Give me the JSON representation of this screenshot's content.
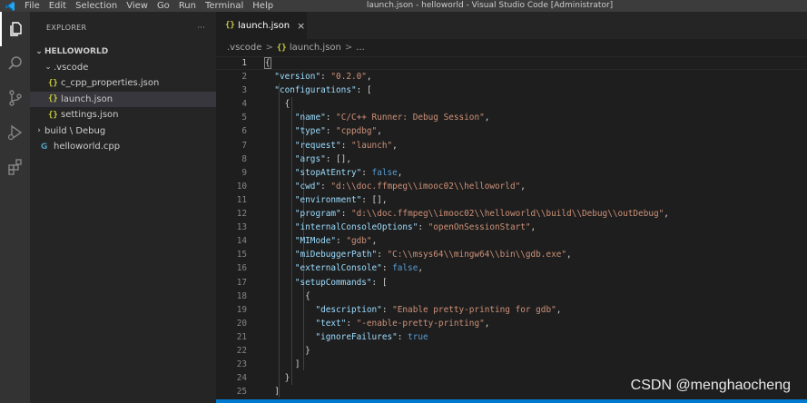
{
  "window": {
    "title": "launch.json - helloworld - Visual Studio Code [Administrator]",
    "menu": [
      "File",
      "Edit",
      "Selection",
      "View",
      "Go",
      "Run",
      "Terminal",
      "Help"
    ]
  },
  "sidebar": {
    "header": "EXPLORER",
    "more": "···",
    "folder": "HELLOWORLD",
    "items": [
      {
        "label": ".vscode",
        "type": "folder"
      },
      {
        "label": "c_cpp_properties.json",
        "type": "json"
      },
      {
        "label": "launch.json",
        "type": "json"
      },
      {
        "label": "settings.json",
        "type": "json"
      },
      {
        "label": "build \\ Debug",
        "type": "folder"
      },
      {
        "label": "helloworld.cpp",
        "type": "cpp"
      }
    ]
  },
  "tabs": [
    {
      "label": "launch.json",
      "close": "×",
      "icon": "{}"
    }
  ],
  "breadcrumb": {
    "parts": [
      ".vscode",
      "launch.json",
      "..."
    ],
    "separator": ">"
  },
  "editor": {
    "line_numbers": [
      "1",
      "2",
      "3",
      "4",
      "5",
      "6",
      "7",
      "8",
      "9",
      "10",
      "11",
      "12",
      "13",
      "14",
      "15",
      "16",
      "17",
      "18",
      "19",
      "20",
      "21",
      "22",
      "23",
      "24",
      "25"
    ]
  },
  "code": {
    "version_key": "\"version\"",
    "version_val": "\"0.2.0\"",
    "configurations_key": "\"configurations\"",
    "name_key": "\"name\"",
    "name_val": "\"C/C++ Runner: Debug Session\"",
    "type_key": "\"type\"",
    "type_val": "\"cppdbg\"",
    "request_key": "\"request\"",
    "request_val": "\"launch\"",
    "args_key": "\"args\"",
    "stopAtEntry_key": "\"stopAtEntry\"",
    "stopAtEntry_val": "false",
    "cwd_key": "\"cwd\"",
    "cwd_val": "\"d:\\\\doc.ffmpeg\\\\imooc02\\\\helloworld\"",
    "environment_key": "\"environment\"",
    "program_key": "\"program\"",
    "program_val": "\"d:\\\\doc.ffmpeg\\\\imooc02\\\\helloworld\\\\build\\\\Debug\\\\outDebug\"",
    "internalConsoleOptions_key": "\"internalConsoleOptions\"",
    "internalConsoleOptions_val": "\"openOnSessionStart\"",
    "MIMode_key": "\"MIMode\"",
    "MIMode_val": "\"gdb\"",
    "miDebuggerPath_key": "\"miDebuggerPath\"",
    "miDebuggerPath_val": "\"C:\\\\msys64\\\\mingw64\\\\bin\\\\gdb.exe\"",
    "externalConsole_key": "\"externalConsole\"",
    "externalConsole_val": "false",
    "setupCommands_key": "\"setupCommands\"",
    "description_key": "\"description\"",
    "description_val": "\"Enable pretty-printing for gdb\"",
    "text_key": "\"text\"",
    "text_val": "\"-enable-pretty-printing\"",
    "ignoreFailures_key": "\"ignoreFailures\"",
    "ignoreFailures_val": "true"
  },
  "watermark": "CSDN @menghaocheng",
  "colors": {
    "accent": "#007acc",
    "key": "#9cdcfe",
    "string": "#ce9178",
    "keyword": "#569cd6"
  }
}
